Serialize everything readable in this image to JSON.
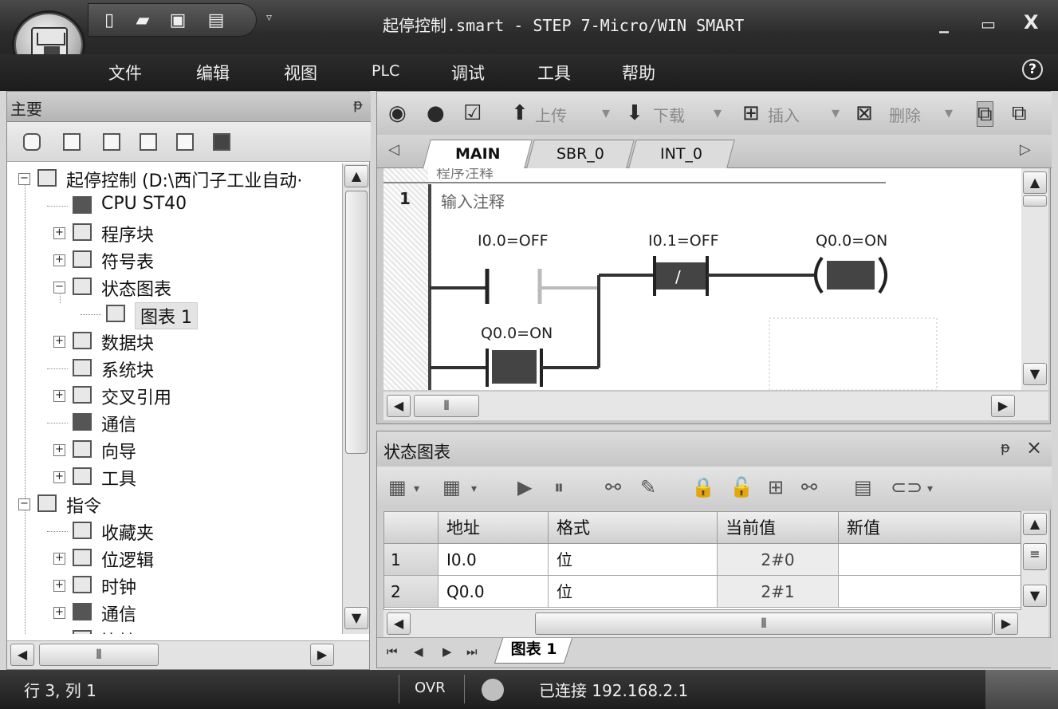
{
  "window": {
    "title": "起停控制.smart - STEP 7-Micro/WIN SMART",
    "controls": {
      "minimize": "_",
      "restore": "▭",
      "close": "X"
    }
  },
  "quick_access": {
    "icons": [
      "new-icon",
      "open-icon",
      "save-icon",
      "print-icon"
    ],
    "dropdown": "▿"
  },
  "menu": {
    "items": [
      "文件",
      "编辑",
      "视图",
      "PLC",
      "调试",
      "工具",
      "帮助"
    ],
    "help": "?"
  },
  "project_panel": {
    "title": "主要",
    "pin": "ᵽ",
    "tree": [
      {
        "label": "起停控制 (D:\\西门子工业自动·",
        "expander": "−",
        "icon": "project-icon"
      },
      {
        "label": "CPU ST40",
        "expander": "",
        "icon": "cpu-icon"
      },
      {
        "label": "程序块",
        "expander": "+",
        "icon": "folder-icon"
      },
      {
        "label": "符号表",
        "expander": "+",
        "icon": "folder-icon"
      },
      {
        "label": "状态图表",
        "expander": "−",
        "icon": "folder-icon"
      },
      {
        "label": "图表 1",
        "expander": "",
        "icon": "chart-table-icon"
      },
      {
        "label": "数据块",
        "expander": "+",
        "icon": "folder-icon"
      },
      {
        "label": "系统块",
        "expander": "",
        "icon": "system-block-icon"
      },
      {
        "label": "交叉引用",
        "expander": "+",
        "icon": "folder-icon"
      },
      {
        "label": "通信",
        "expander": "",
        "icon": "communication-icon"
      },
      {
        "label": "向导",
        "expander": "+",
        "icon": "wizard-icon"
      },
      {
        "label": "工具",
        "expander": "+",
        "icon": "folder-icon"
      },
      {
        "label": "指令",
        "expander": "−",
        "icon": "instructions-icon"
      },
      {
        "label": "收藏夹",
        "expander": "",
        "icon": "favorites-icon"
      },
      {
        "label": "位逻辑",
        "expander": "+",
        "icon": "bit-logic-icon"
      },
      {
        "label": "时钟",
        "expander": "+",
        "icon": "clock-icon"
      },
      {
        "label": "通信",
        "expander": "+",
        "icon": "communication-icon"
      },
      {
        "label": "比较",
        "expander": "+",
        "icon": "compare-icon"
      }
    ]
  },
  "editor": {
    "toolbar": {
      "upload": "上传",
      "download": "下载",
      "insert": "插入",
      "delete": "删除"
    },
    "tabs": [
      "MAIN",
      "SBR_0",
      "INT_0"
    ],
    "network": {
      "number": "1",
      "comment": "输入注释",
      "header_fragment": "程序注释",
      "contacts": [
        {
          "label": "I0.0=OFF"
        },
        {
          "label": "I0.1=OFF",
          "symbol": "/"
        },
        {
          "label": "Q0.0=ON"
        }
      ],
      "coil": {
        "label": "Q0.0=ON"
      }
    }
  },
  "status_chart": {
    "title": "状态图表",
    "pin": "ᵽ",
    "close": "×",
    "columns": [
      "地址",
      "格式",
      "当前值",
      "新值"
    ],
    "rows": [
      {
        "index": "1",
        "address": "I0.0",
        "format": "位",
        "current": "2#0",
        "new": ""
      },
      {
        "index": "2",
        "address": "Q0.0",
        "format": "位",
        "current": "2#1",
        "new": ""
      }
    ],
    "sheet_tab": "图表 1",
    "nav": [
      "⏮",
      "◀",
      "▶",
      "⏭"
    ]
  },
  "statusbar": {
    "position": "行 3, 列 1",
    "mode": "OVR",
    "connection": "已连接 192.168.2.1"
  }
}
